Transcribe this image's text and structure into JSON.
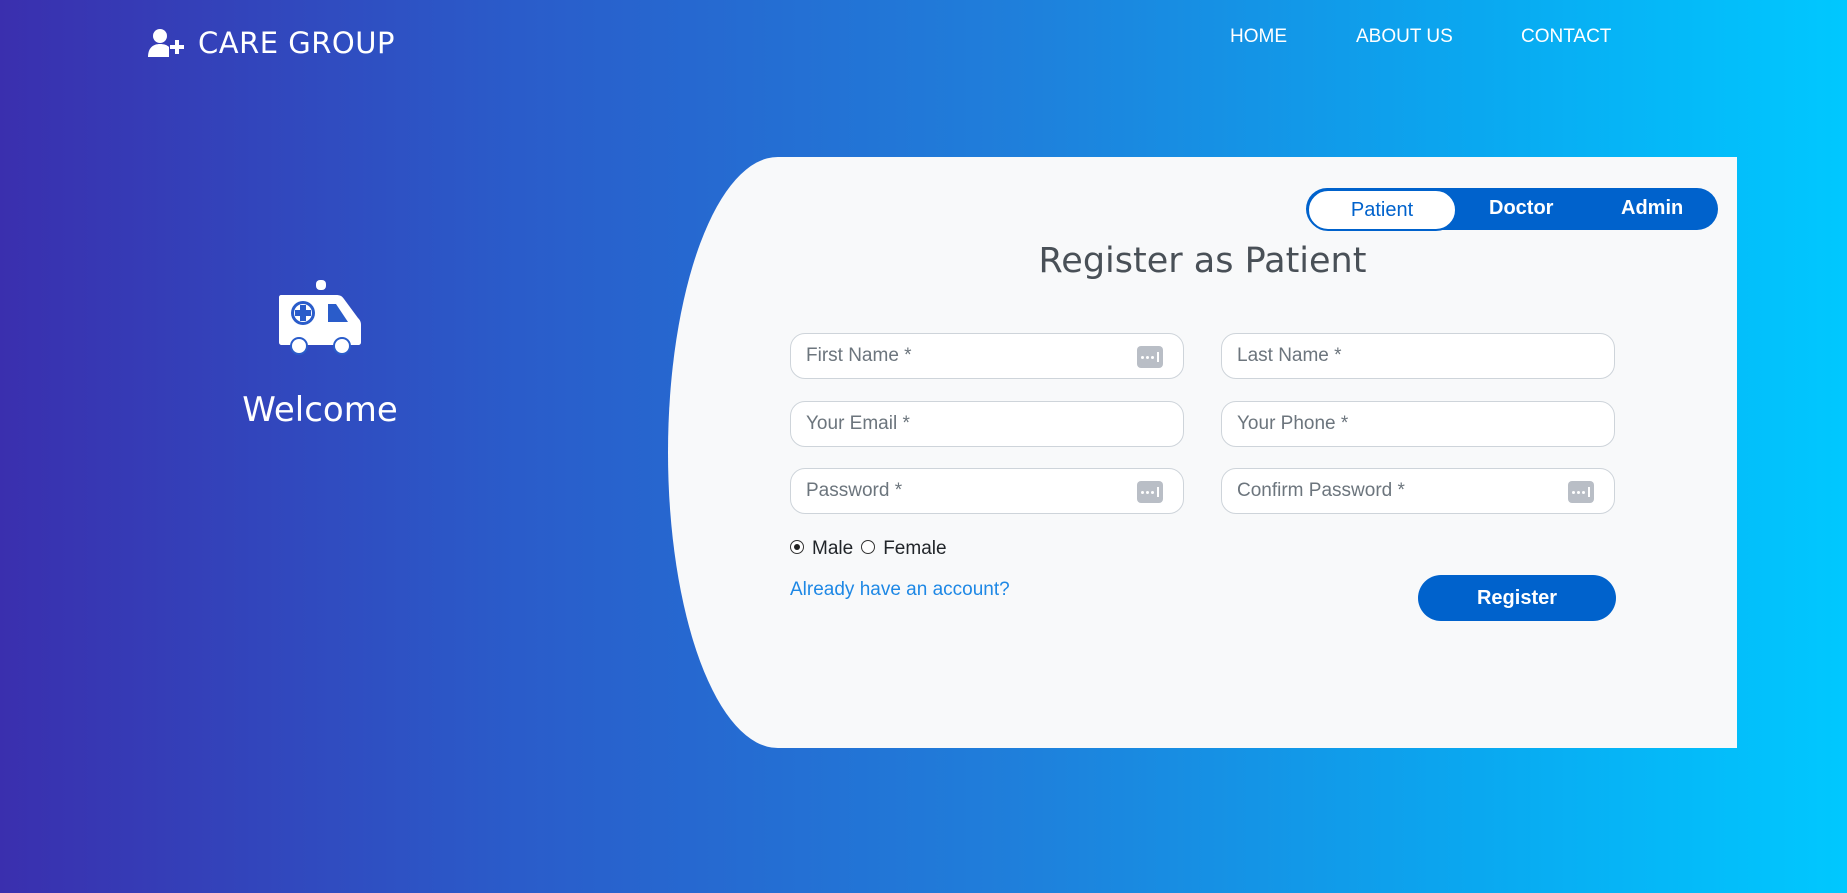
{
  "nav": {
    "brand": "CARE GROUP",
    "brand_icon": "user-plus-icon",
    "links": [
      "HOME",
      "ABOUT US",
      "CONTACT"
    ]
  },
  "welcome": {
    "icon": "ambulance-icon",
    "title": "Welcome"
  },
  "roles": {
    "options": [
      "Patient",
      "Doctor",
      "Admin"
    ],
    "selected": "Patient"
  },
  "form": {
    "title": "Register as Patient",
    "fields": {
      "first_name": "First Name *",
      "last_name": "Last Name *",
      "email": "Your Email *",
      "phone": "Your Phone *",
      "password": "Password *",
      "confirm_password": "Confirm Password *"
    },
    "gender": {
      "options": [
        "Male",
        "Female"
      ],
      "selected": "Male"
    },
    "account_link": "Already have an account?",
    "submit": "Register"
  },
  "colors": {
    "primary": "#0062cc",
    "link": "#1e88e5",
    "card_bg": "#f8f9fa",
    "gradient_start": "#3a2fae",
    "gradient_end": "#00c8ff"
  }
}
